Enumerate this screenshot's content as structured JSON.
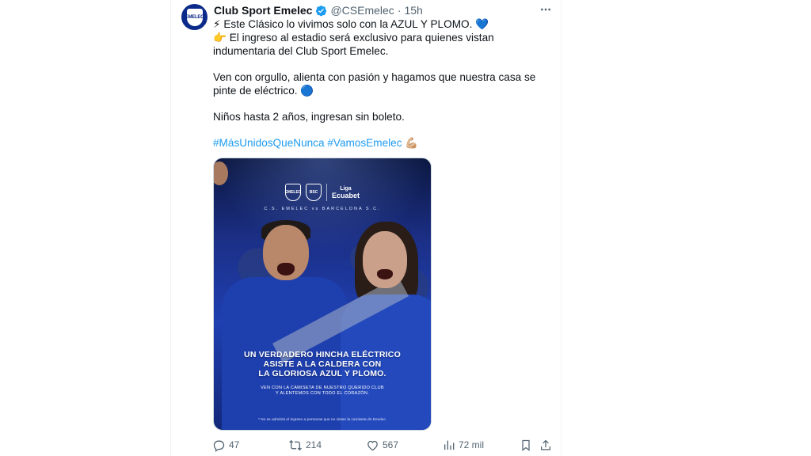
{
  "tweet": {
    "author_name": "Club Sport Emelec",
    "handle": "@CSEmelec",
    "separator": "·",
    "time": "15h",
    "avatar_text": "EMELEC",
    "lines": {
      "l1_emoji": "⚡",
      "l1": "Este Clásico lo vivimos solo con la AZUL Y PLOMO.",
      "l1_end_emoji": "💙",
      "l2_emoji": "👉",
      "l2": "El ingreso al estadio será exclusivo para quienes vistan indumentaria del Club Sport Emelec.",
      "l3": "Ven con orgullo, alienta con pasión y hagamos que nuestra casa se pinte de eléctrico.",
      "l3_end_emoji": "🔵",
      "l4": "Niños hasta 2 años, ingresan sin boleto.",
      "hashtags": "#MásUnidosQueNunca #VamosEmelec",
      "hashtags_emoji": "💪🏼"
    }
  },
  "media": {
    "logo1": "EMELEC",
    "logo2": "BSC",
    "liga_small": "Liga",
    "liga_big": "Ecuabet",
    "match_line": "C.S. EMELEC vs BARCELONA S.C.",
    "headline_1": "UN VERDADERO HINCHA ELÉCTRICO",
    "headline_2": "ASISTE A LA CALDERA CON",
    "headline_3": "LA GLORIOSA AZUL Y PLOMO.",
    "sub_1": "VEN CON LA CAMISETA DE NUESTRO QUERIDO CLUB",
    "sub_2": "Y ALENTEMOS CON TODO EL CORAZÓN.",
    "disclaimer": "* No se admitirá el ingreso a personas que no vistan la camiseta de Emelec."
  },
  "actions": {
    "replies": "47",
    "reposts": "214",
    "likes": "567",
    "views": "72 mil"
  },
  "colors": {
    "link": "#1d9bf0",
    "secondary_text": "#536471",
    "verified": "#1d9bf0"
  }
}
